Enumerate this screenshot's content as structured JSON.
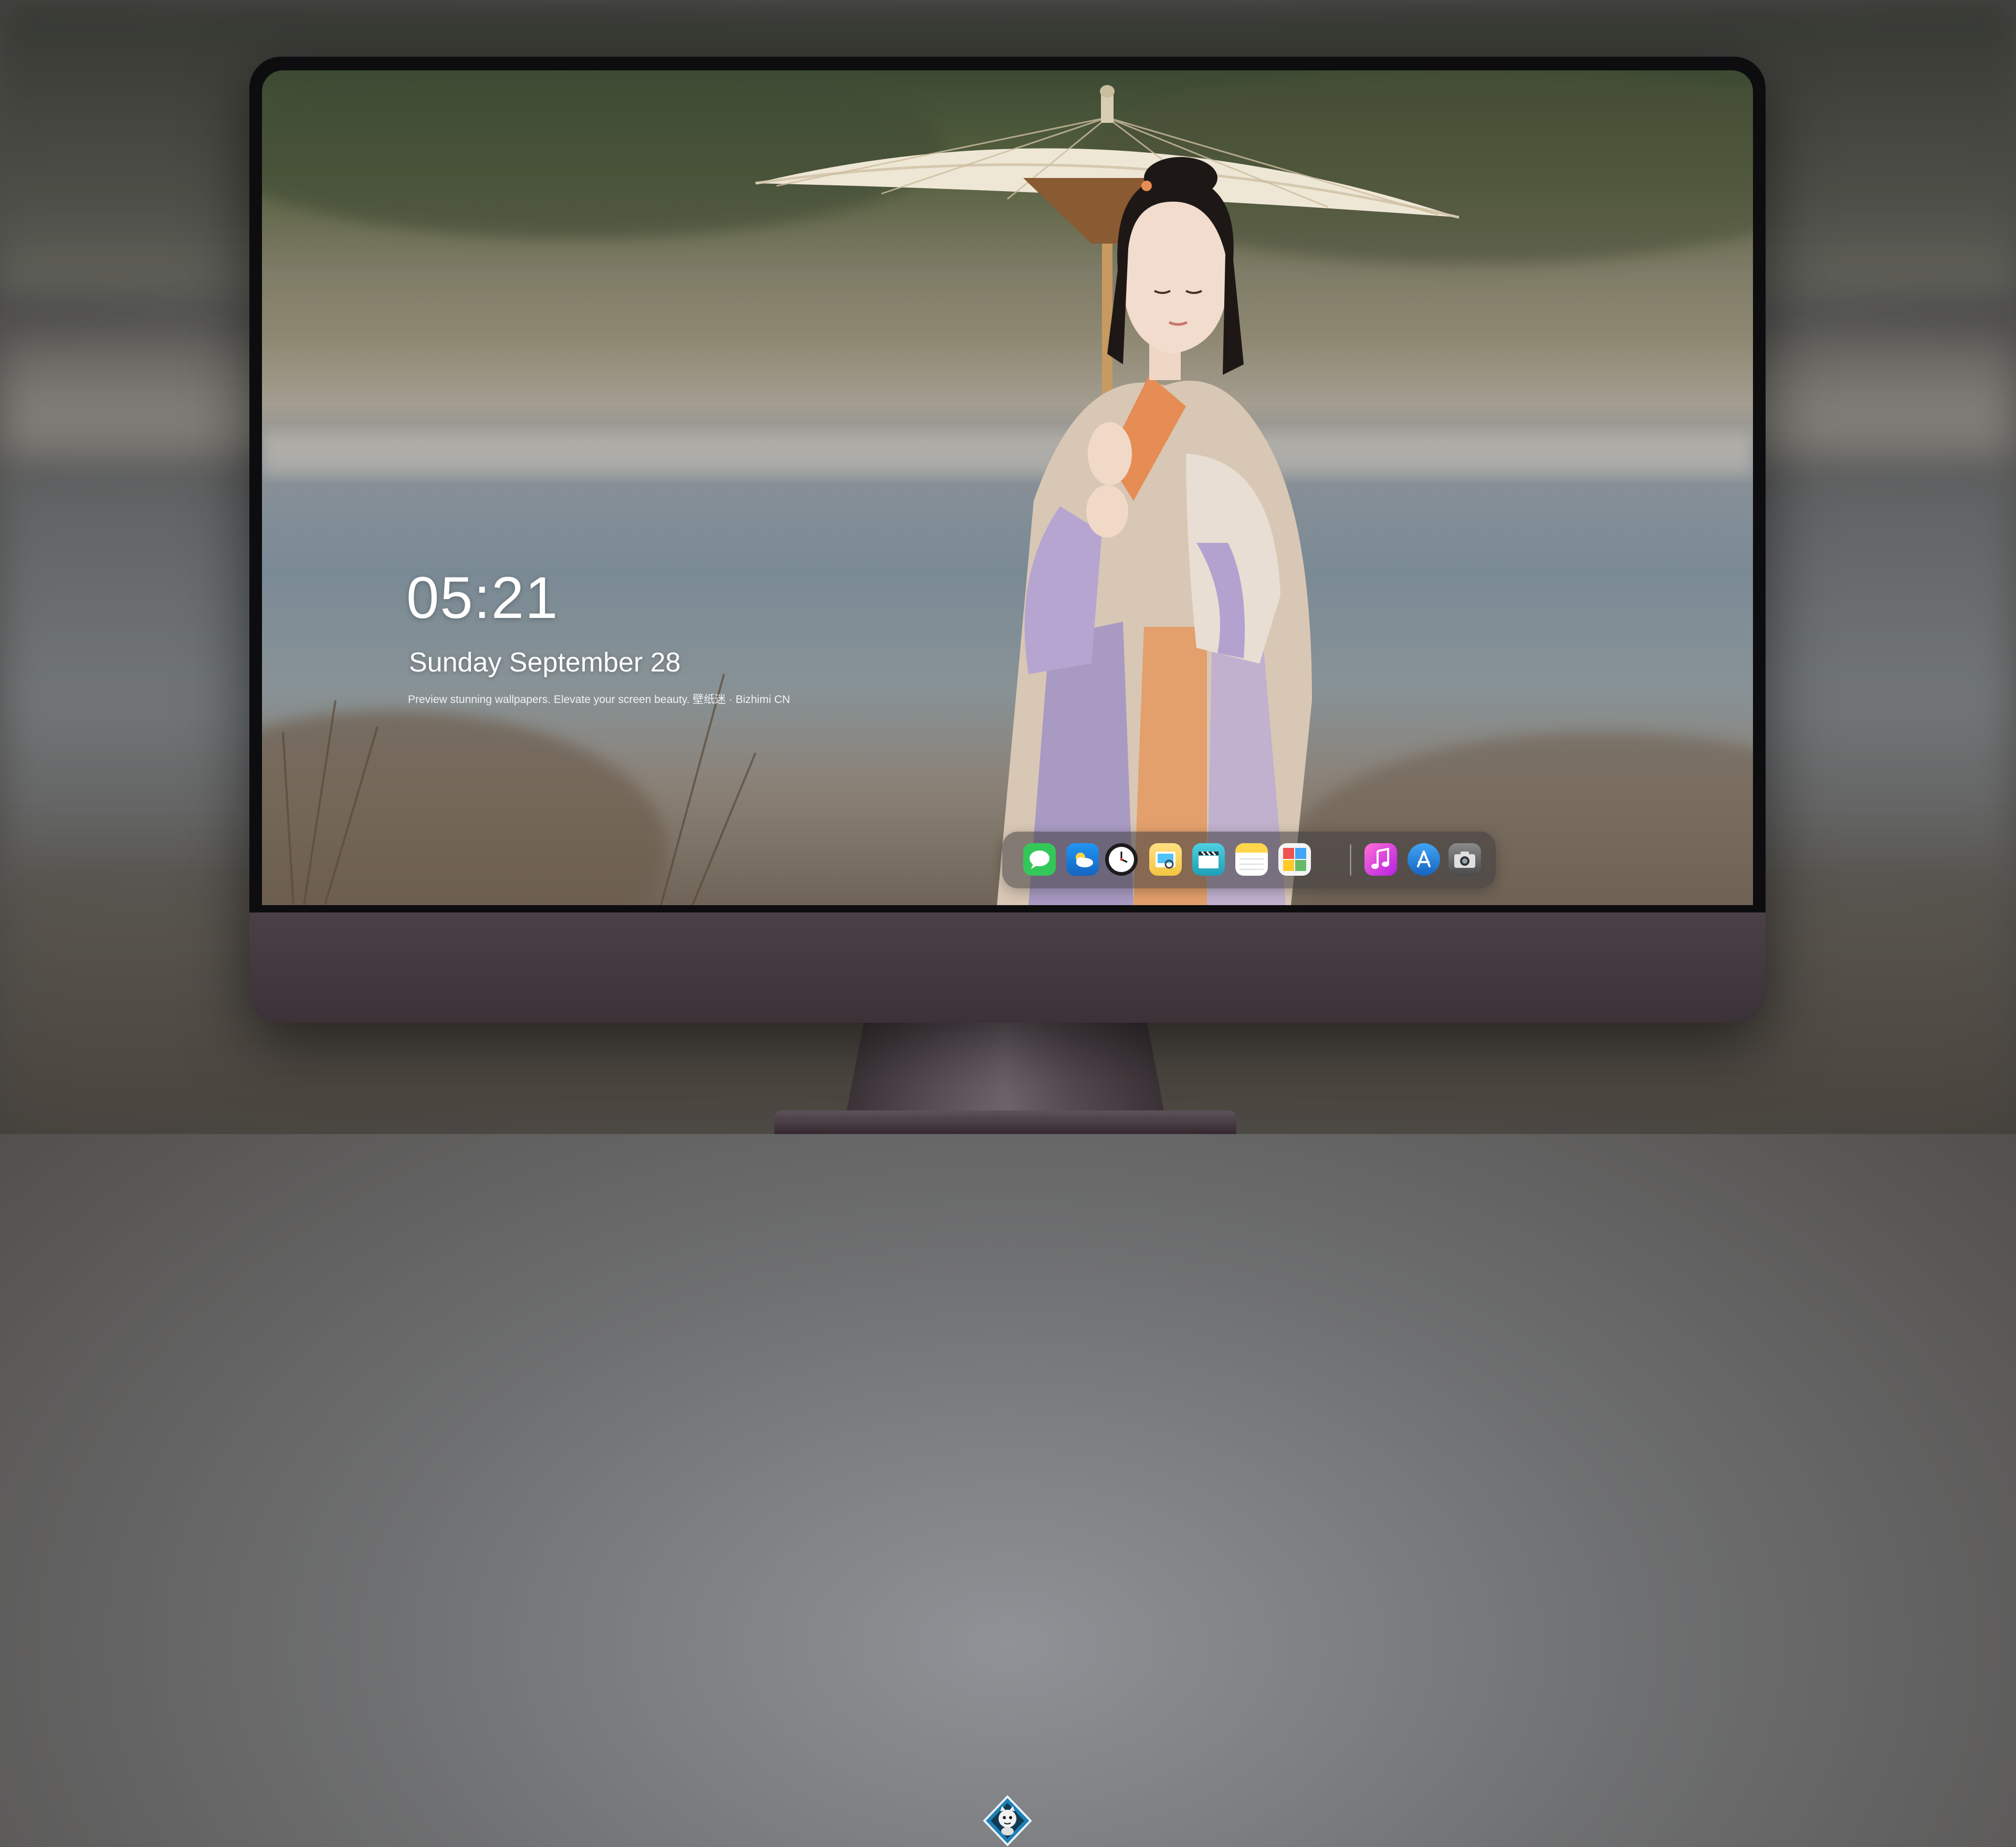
{
  "lock_screen": {
    "time": "05:21",
    "date": "Sunday September  28",
    "tagline": "Preview stunning wallpapers. Elevate your screen beauty. 壁纸迷 · Bizhimi CN"
  },
  "dock": {
    "apps": [
      {
        "name": "messages-icon",
        "color": "#34c759"
      },
      {
        "name": "weather-icon",
        "color": "#1e88e5"
      },
      {
        "name": "clock-icon",
        "color": "#1c1c1e"
      },
      {
        "name": "preview-icon",
        "color": "#f4c542"
      },
      {
        "name": "video-clapper-icon",
        "color": "#2bb6d1"
      },
      {
        "name": "notes-icon",
        "color": "#ffd54a"
      },
      {
        "name": "photo-collage-icon",
        "color": "#4caf50"
      },
      {
        "name": "music-icon",
        "color": "#e040fb"
      },
      {
        "name": "app-store-icon",
        "color": "#1e88e5"
      },
      {
        "name": "camera-icon",
        "color": "#555555"
      }
    ]
  },
  "colors": {
    "accent": "#ffffff",
    "bezel": "#3b3238"
  }
}
